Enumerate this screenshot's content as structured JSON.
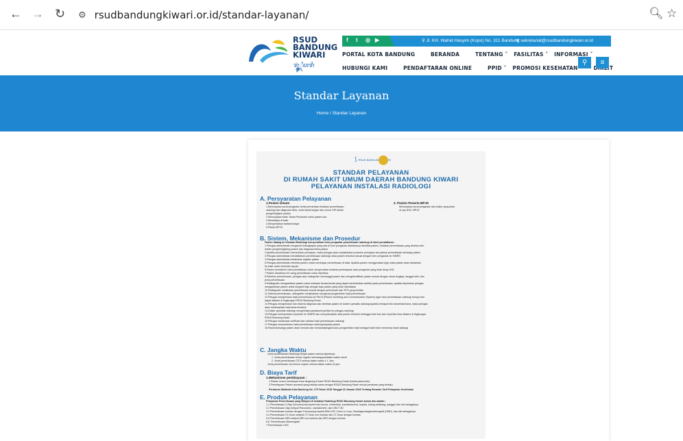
{
  "browser": {
    "url": "rsudbandungkiwari.or.id/standar-layanan/"
  },
  "site": {
    "logo_line1": "RSUD",
    "logo_line2": "BANDUNG",
    "logo_line3": "KIWARI",
    "logo_script": "ꦫꦸꦁ꧀ꦏꦶꦮꦫꦶ",
    "address": "Jl. KH. Wahid Hasyim (Kopo) No. 311 Bandung",
    "email": "sekretariat@rsudbandungkiwari.or.id",
    "menu_top": [
      "PORTAL KOTA BANDUNG",
      "BERANDA",
      "TENTANG ˅",
      "FASILITAS ˅",
      "INFORMASI ˅"
    ],
    "menu_bottom": [
      "HUBUNGI KAMI",
      "PENDAFTARAN ONLINE",
      "PPID ˅",
      "PROMOSI KESEHATAN",
      "DIKLIT"
    ]
  },
  "hero": {
    "title": "Standar Layanan",
    "breadcrumb": "Home  / Standar Layanan"
  },
  "poster": {
    "logo_text": "RSUD BANDUNG KIWARI",
    "title1": "STANDAR PELAYANAN",
    "title2": "DI RUMAH SAKIT UMUM DAERAH BANDUNG KIWARI",
    "title3": "PELAYANAN INSTALASI RADIOLOGI",
    "secA": "A. Persyaratan Pelayanan",
    "a_sub1": "1.Pasien Umum",
    "a_sub2": "2. Pasien Peserta BPJS",
    "a_lines": [
      "1.Menunjukan surat pengantar berisi permintaan tindakan pemeriksaan",
      "radiologi dan diagnosa klinis, serta tanda tangan dan nomor SIP dokter",
      "pengirim/jejarin pasien",
      "2.Menunjukan Kartu Tanda Penduduk untuk pasien luar",
      "3.Membayar di kasir",
      "4.Menyerahkan kwitansi bayar",
      "5.Pasien BPJS"
    ],
    "a_right": [
      "Menunjukan surat pengantar dari dokter yang telah",
      "di cap JKN / BPJS"
    ],
    "secB": "B. Sistem, Mekanisme dan Prosedur",
    "b_lines": [
      "Pasien datang ke Instalasi Radiologi menyerahkan form pengantar pemeriksaan radiologi di loket pendaftaran :",
      "1.Petugas administrasi mengecek kelengkapan yang ada di form pengantar diantaranya identitas pasien, tindakan pemeriksaan yang diminta oleh",
      "dokter pengirim/jejaring pasien dan diagnosa klinis pasien",
      "2.Apabila pemeriksaan memerlukan persiapan, maka petugas akan menjelaskan prosedur persiapan dan jadwal pemeriksaan terhadap pasien",
      "3.Petugas administrasi mendaftarkan pemeriksaan radiologi untuk pasien tersebut sesuai dengan form pengantar ke SIMRS",
      "4.Petugas administrasi melakukan register pasien",
      "5.Petugas administrasi meminta pasien untuk membayar pemeriksaan di kasir. Apabila pasien menggunakan bpjs maka pasien akan diarahkan",
      "ke kasir untuk meminta cap jkn",
      "6.Pasien kembali ke loket pendaftaran untuk menyerahkan kwitansi pembayaran atau pengantar yang telah dicap JKN",
      "7.Pasien diarahkan ke ruang pemeriksaan untuk diperiksa",
      "8.Sebelum pemeriksaan, petugas atau radiografer memanggil pasien dan mengidentifikasi pasien sesuai dengan nama lengkap, tanggal lahir, dan",
      "jenis pemeriksaan",
      "9.Radiografer mengarahkan pasien untuk melepas benda-benda yang dapat menimbulkan artefak pada pemeriksaan, apabila diperlukan petugas",
      "mengarahkan pasien untuk berganti baju dengan baju pasien yang telah disediakan",
      "10.Radiografer melakukan pemeriksaan sesuai dengan permintaan dan SPO yang berlaku",
      "11.Selesai pemeriksaan, radiografer menjelaskan mengenai pengambilan hasil pemeriksaan",
      "12.Petugas mengirimkan hasil pemeriksaan ke PACS (Picture Archiving and Communication System) agar hasil pemeriksaan radiologi berupa foto",
      "dapat diakses di lingkungan RSUD Bandung Kiwari",
      "13.Petugas mengirimkan foto beserta diagnosa dan identitas pasien ke dokter spesialis radiologi apabila terdapat foto lama/hasil lama, maka petugas",
      "akan melampirkan hasil lama tersebut",
      "14.Dokter spesialis radiologi mengirimkan jawaban/expertise ke petugas radiologi",
      "15.Petugas memasukkan expertise ke SIMRS dan menyelesaikan data pasien tersebut sehingga hasil foto dan expertise bisa diakses di lingkungan",
      "RSUD Bandung Kiwari",
      "16.Petugas melakukan verifikasi dan validasi hasil pemeriksaan radiologi",
      "17.Petugas menyerahkan hasil pemeriksaan radiologi kepada pasien",
      "18.Pasien/keluarga pasien akan menulis dan menandatangani buku pengambilan hasil sebagai bukti telah menerima hasil radiologi"
    ],
    "secC": "C. Jangka Waktu",
    "c_lines": [
      "Lama pemeriksaan Radiologi (Sejak pasien selesai diperiksa) :",
      "1. Jenis pemeriksaan thorax reguler sekurangnya/dalam waktu  menit",
      "2. Jenis pemeriksaan CITO selesai dalam waktu ± 1 Jam",
      "Jenis pemeriksaan non-thorax reguler selesai dalam waktu 24 jam"
    ],
    "secD": "D. Biaya Tarif",
    "d_sub": "1.Mekanisme pembiayaan :",
    "d_lines": [
      "1.Pasien umum membayar tunai langsung di kasir RSUD Bandung Kiwari (lokasi pada pintu)",
      "2.Pembiayaan Pasien asuransi yang bekerja sama dengan RSUD Bandung Kiwari sesuai peraturan yang berlaku",
      "Peraturan Walikota Kota Bandung No. 175 Tahun 2018 Tanggal 23 Januari 2018 Tentang Besaran Tarif Pelayanan Kesehatan"
    ],
    "secE": "E. Produk Pelayanan",
    "e_lines": [
      "Pelayanan Pemeriksaan yang dilayani di Instalasi Radiologi RSUD Bandung Kiwari antara lain adalah :",
      "1.1 Pemeriksaan X-Ray Konvensional seperti foto thorax, extremitas, kraniakolumna, kepala, tulang belakang, panggul dan lain sebagainya",
      "2.2 Pemeriksaan Gigi meliputi Panoramic, cephalometri, dan CBCT 3D",
      "3.3 Pemeriksaan kontras dengan Fluoroscopy seperti BNO-IVP, Colon in Loop, Oesofagomaagduodenografi (OMD), dan lain sebagainya",
      "4.4 Pemeriksaan CT-Scan meliputi CT-Scan non kontras dan CT-Scan dengan kontras",
      "5.5 Pemeriksaan MRI meliputi MRI non kontras dan MRI dengan kontras",
      "6.6. Pemeriksaan Mammografi",
      "7.Pemeriksaan USG"
    ]
  }
}
